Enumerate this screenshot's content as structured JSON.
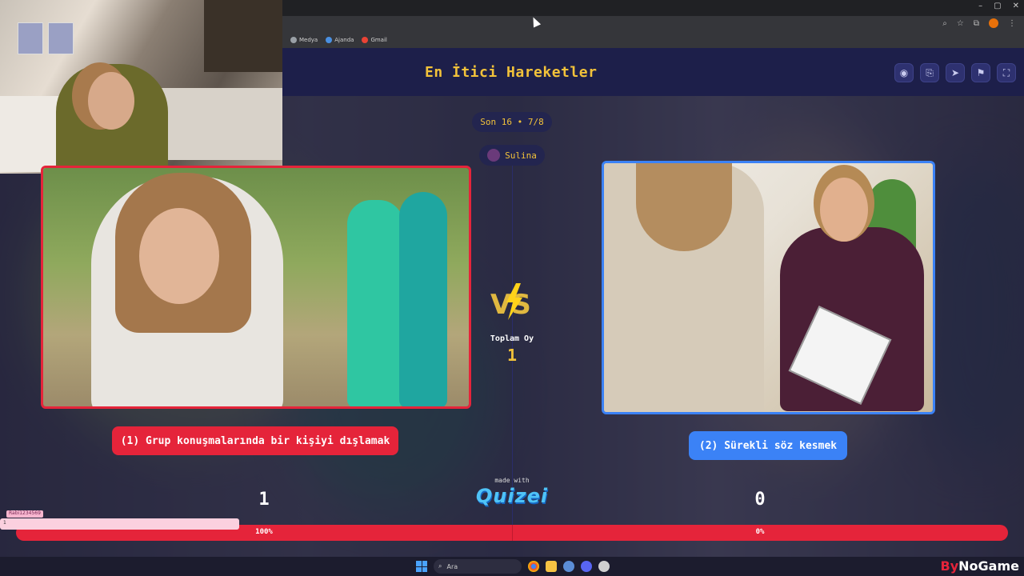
{
  "browser": {
    "window_controls": [
      "–",
      "▢",
      "✕"
    ],
    "bookmarks": [
      {
        "label": "Medya",
        "icon": "infinity-icon",
        "color": "#9aa0a6"
      },
      {
        "label": "Ajanda",
        "icon": "globe-icon",
        "color": "#4a90e2"
      },
      {
        "label": "Gmail",
        "icon": "gmail-icon",
        "color": "#ea4335"
      }
    ],
    "toolbar_icons": [
      "zoom-icon",
      "star-icon",
      "extensions-icon",
      "profile-icon",
      "menu-icon"
    ]
  },
  "header": {
    "title": "En İtici Hareketler",
    "buttons": [
      "eye-icon",
      "share-icon",
      "send-icon",
      "flag-icon",
      "fullscreen-icon"
    ]
  },
  "round": {
    "label": "Son 16 • 7/8"
  },
  "player": {
    "name": "Sulina"
  },
  "left_option": {
    "label": "(1) Grup konuşmalarında bir kişiyi dışlamak",
    "votes": "1",
    "percent": "100%",
    "color": "#e5243a"
  },
  "right_option": {
    "label": "(2) Sürekli söz kesmek",
    "votes": "0",
    "percent": "0%",
    "color": "#3b82f6"
  },
  "center": {
    "vs": "VS",
    "total_label": "Toplam Oy",
    "total_value": "1"
  },
  "branding": {
    "made_with": "made with",
    "logo": "QUIZEI"
  },
  "vote_share": {
    "left": 1.0,
    "right": 0.0
  },
  "chat": {
    "user": "Rabi1234569",
    "message": "1"
  },
  "taskbar": {
    "search_placeholder": "Ara",
    "watermark_a": "By",
    "watermark_b": "NoGame"
  }
}
